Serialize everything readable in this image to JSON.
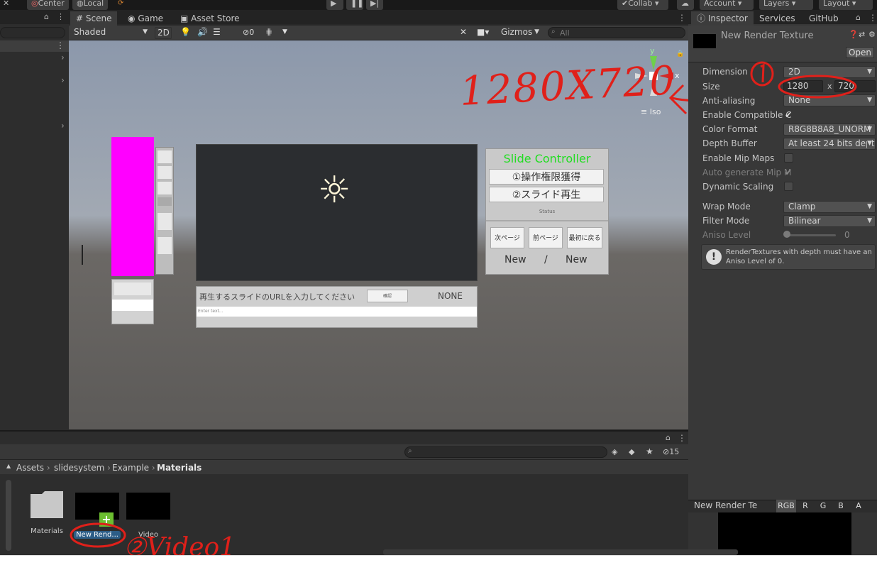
{
  "top_toolbar": {
    "pivot_center": "Center",
    "pivot_local": "Local",
    "collab": "Collab",
    "account": "Account",
    "layers": "Layers",
    "layout": "Layout"
  },
  "scene_tabs": {
    "scene": "Scene",
    "game": "Game",
    "asset_store": "Asset Store"
  },
  "scene_toolbar": {
    "shading": "Shaded",
    "mode_2d": "2D",
    "hidden_count": "0",
    "gizmos": "Gizmos",
    "search_placeholder": "All"
  },
  "scene_content": {
    "gizmo_y": "y",
    "gizmo_x": "x",
    "iso_label": "Iso",
    "slide_controller_title": "Slide Controller",
    "btn_acquire": "①操作権限獲得",
    "btn_play_slide": "②スライド再生",
    "status_label": "Status",
    "btn_next": "次ページ",
    "btn_prev": "前ページ",
    "btn_first": "最初に戻る",
    "page_current": "New",
    "page_sep": "/",
    "page_total": "New",
    "url_prompt": "再生するスライドのURLを入力してください",
    "url_small_button": "確認",
    "url_status": "NONE",
    "url_input_placeholder": "Enter text..."
  },
  "inspector": {
    "tabs": [
      "Inspector",
      "Services",
      "GitHub"
    ],
    "asset_name": "New Render Texture",
    "open_button": "Open",
    "fields": {
      "dimension_label": "Dimension",
      "dimension_value": "2D",
      "size_label": "Size",
      "size_width": "1280",
      "size_x": "x",
      "size_height": "720",
      "anti_aliasing_label": "Anti-aliasing",
      "anti_aliasing_value": "None",
      "enable_compat_label": "Enable Compatible C",
      "color_format_label": "Color Format",
      "color_format_value": "R8G8B8A8_UNORM",
      "depth_buffer_label": "Depth Buffer",
      "depth_buffer_value": "At least 24 bits dept",
      "mip_maps_label": "Enable Mip Maps",
      "auto_mip_label": "Auto generate Mip M",
      "dynamic_scaling_label": "Dynamic Scaling",
      "wrap_mode_label": "Wrap Mode",
      "wrap_mode_value": "Clamp",
      "filter_mode_label": "Filter Mode",
      "filter_mode_value": "Bilinear",
      "aniso_label": "Aniso Level",
      "aniso_value": "0"
    },
    "aniso_level_fraction": 0,
    "info_message": "RenderTextures with depth must have an Aniso Level of 0.",
    "preview_title": "New Render Te",
    "channels": [
      "RGB",
      "R",
      "G",
      "B",
      "A"
    ]
  },
  "project": {
    "breadcrumb": [
      "Assets",
      "slidesystem",
      "Example",
      "Materials"
    ],
    "hidden_count": "15",
    "assets": [
      {
        "name": "Materials",
        "type": "folder"
      },
      {
        "name": "New Rend...",
        "type": "render-texture"
      },
      {
        "name": "Video",
        "type": "video"
      }
    ]
  },
  "annotations": {
    "size_note": "1280X720",
    "circle_one": "①",
    "video_note": "②Video1"
  },
  "colors": {
    "annotation_red": "#e0201a",
    "magenta_panel": "#ff00ff",
    "controller_title_green": "#22dd22",
    "selected_blue": "#2c5d87"
  }
}
